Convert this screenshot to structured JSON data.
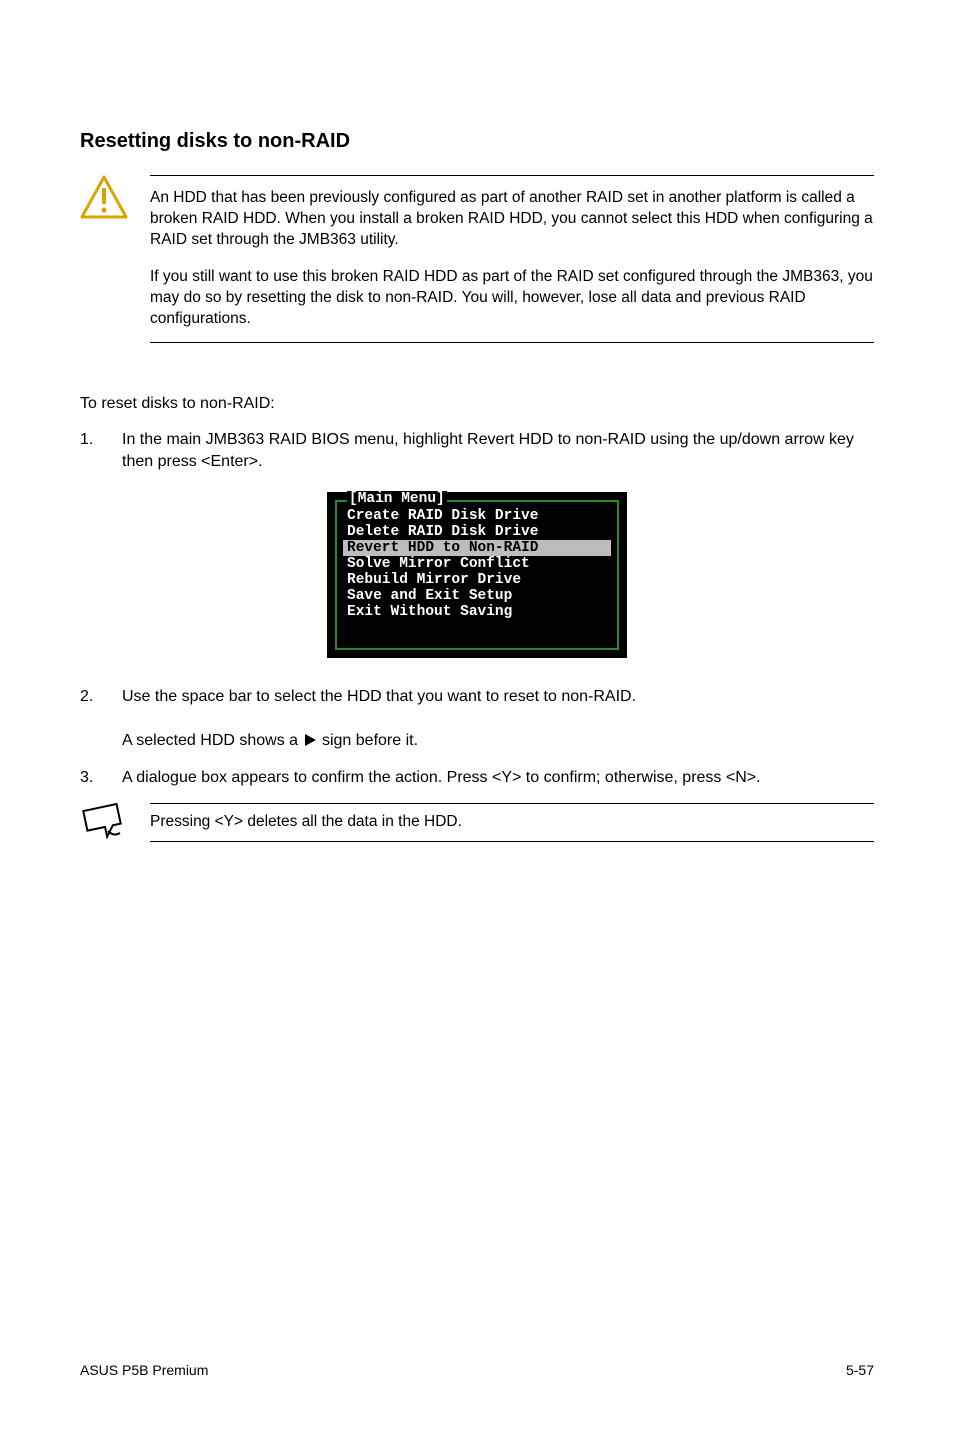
{
  "heading": "Resetting disks to non-RAID",
  "warning": {
    "p1": "An HDD that has been previously configured as part of another RAID set in another platform is called a broken RAID HDD. When you install a broken RAID HDD, you cannot select this HDD when configuring a RAID set through the JMB363 utility.",
    "p2": "If you still want to use this broken RAID HDD as part of the RAID set configured through the JMB363, you may do so by resetting the disk to non-RAID. You will, however, lose all data and previous RAID configurations."
  },
  "intro": "To reset disks to non-RAID:",
  "steps": {
    "s1": "In the main JMB363 RAID BIOS menu, highlight Revert HDD to non-RAID using the up/down arrow key then press <Enter>.",
    "s2a": "Use the space bar to select the HDD that you want to reset to non-RAID.",
    "s2b_before": "A selected HDD shows a ",
    "s2b_after": " sign before it.",
    "s3": "A dialogue box appears to confirm the action. Press <Y> to confirm; otherwise, press <N>."
  },
  "bios": {
    "title": "[Main Menu]",
    "items": [
      "Create RAID Disk Drive",
      "Delete RAID Disk Drive",
      "Revert HDD to Non-RAID",
      "Solve Mirror Conflict",
      "Rebuild Mirror Drive",
      "Save and Exit Setup",
      "Exit Without Saving"
    ],
    "highlight_index": 2
  },
  "note": "Pressing <Y> deletes all the data in the HDD.",
  "footer": {
    "left": "ASUS P5B Premium",
    "right": "5-57"
  }
}
